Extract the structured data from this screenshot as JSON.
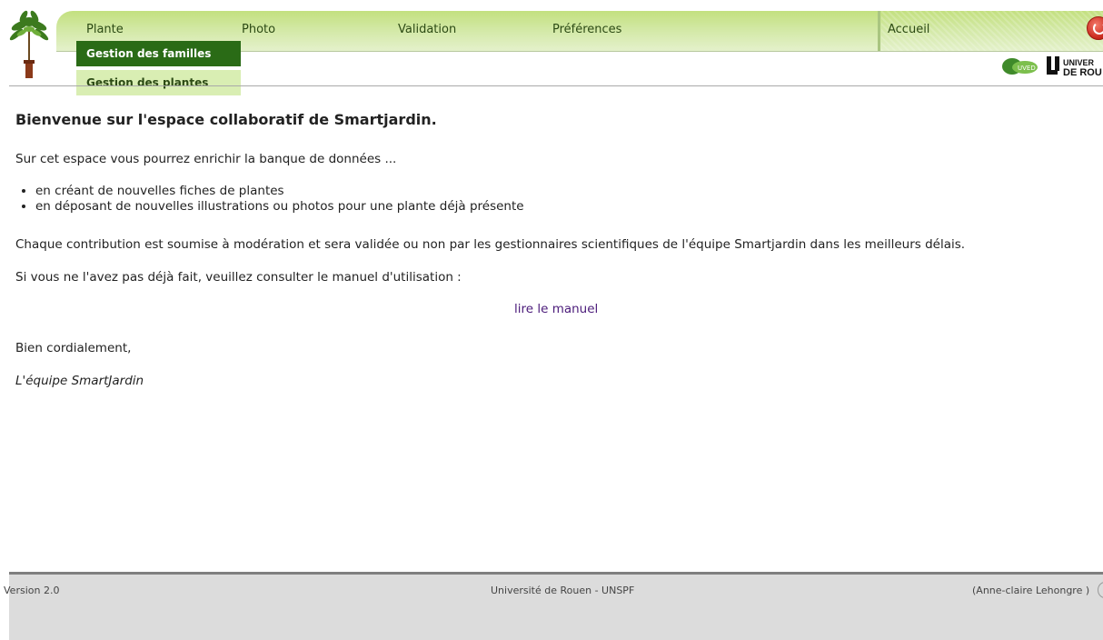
{
  "nav": {
    "items": [
      "Plante",
      "Photo",
      "Validation",
      "Préférences"
    ],
    "home": "Accueil"
  },
  "dropdown": {
    "items": [
      "Gestion des familles",
      "Gestion des plantes"
    ],
    "selected": "Gestion des familles"
  },
  "content": {
    "title": "Bienvenue sur l'espace collaboratif de Smartjardin.",
    "intro": "Sur cet espace vous pourrez enrichir la banque de données ...",
    "bullets": [
      "en créant de nouvelles fiches de plantes",
      "en déposant de nouvelles illustrations ou photos pour une plante déjà présente"
    ],
    "moderation": "Chaque contribution est soumise à modération et sera validée ou non par les gestionnaires scientifiques de l'équipe Smartjardin dans les meilleurs délais.",
    "consult": "Si vous ne l'avez pas déjà fait, veuillez consulter le manuel d'utilisation :",
    "manual_link": "lire le manuel",
    "regards": "Bien cordialement,",
    "signature": "L'équipe SmartJardin"
  },
  "footer": {
    "version": "Version 2.0",
    "university": "Université de Rouen - UNSPF",
    "user": "(Anne-claire Lehongre )"
  },
  "logos": {
    "univ_line1": "UNIVER",
    "univ_line2": "DE ROU",
    "uved": "UVED"
  },
  "icons": {
    "plant_logo": "potted-tree-icon",
    "logout": "power-icon"
  },
  "colors": {
    "nav_bg": "#d2e8a4",
    "dropdown_active": "#2a6b16",
    "dropdown_item": "#d9eeb3",
    "link": "#4b1b7a",
    "footer_bg": "#dcdcdc"
  }
}
